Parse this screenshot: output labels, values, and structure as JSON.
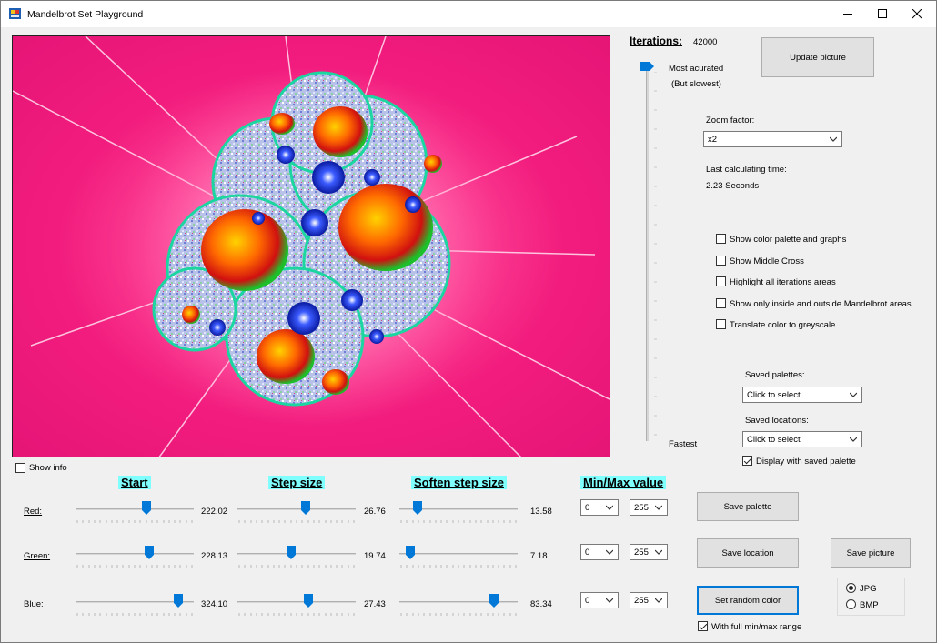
{
  "window": {
    "title": "Mandelbrot Set Playground"
  },
  "iterations": {
    "label": "Iterations:",
    "value": "42000",
    "top_label_line1": "Most acurated",
    "top_label_line2": "(But slowest)",
    "bottom_label": "Fastest"
  },
  "update_button": "Update picture",
  "zoom": {
    "label": "Zoom factor:",
    "value": "x2"
  },
  "calc_time": {
    "label": "Last calculating time:",
    "value": "2.23 Seconds"
  },
  "options": [
    {
      "label": "Show color palette and graphs",
      "checked": false
    },
    {
      "label": "Show Middle Cross",
      "checked": false
    },
    {
      "label": "Highlight all iterations areas",
      "checked": false
    },
    {
      "label": "Show only inside and outside Mandelbrot areas",
      "checked": false
    },
    {
      "label": "Translate color to greyscale",
      "checked": false
    }
  ],
  "saved_palettes": {
    "label": "Saved palettes:",
    "value": "Click to select"
  },
  "saved_locations": {
    "label": "Saved locations:",
    "value": "Click to select"
  },
  "display_saved_palette": {
    "label": "Display with saved palette",
    "checked": true
  },
  "show_info": {
    "label": "Show info",
    "checked": false
  },
  "headers": {
    "start": "Start",
    "step": "Step size",
    "soften": "Soften step size",
    "minmax": "Min/Max value"
  },
  "rows": [
    {
      "label": "Red:",
      "start": "222.02",
      "start_pos": 0.6,
      "step": "26.76",
      "step_pos": 0.58,
      "soften": "13.58",
      "soften_pos": 0.15,
      "min": "0",
      "max": "255"
    },
    {
      "label": "Green:",
      "start": "228.13",
      "start_pos": 0.62,
      "step": "19.74",
      "step_pos": 0.45,
      "soften": "7.18",
      "soften_pos": 0.09,
      "min": "0",
      "max": "255"
    },
    {
      "label": "Blue:",
      "start": "324.10",
      "start_pos": 0.87,
      "step": "27.43",
      "step_pos": 0.6,
      "soften": "83.34",
      "soften_pos": 0.8,
      "min": "0",
      "max": "255"
    }
  ],
  "buttons": {
    "save_palette": "Save  palette",
    "save_location": "Save location",
    "save_picture": "Save picture",
    "set_random_color": "Set random color"
  },
  "full_range": {
    "label": "With full min/max range",
    "checked": true
  },
  "format": [
    {
      "label": "JPG",
      "checked": true
    },
    {
      "label": "BMP",
      "checked": false
    }
  ],
  "colors": {
    "accent": "#0078d7",
    "header_highlight": "#80ffff",
    "fractal_background": "#ef1c7c"
  }
}
